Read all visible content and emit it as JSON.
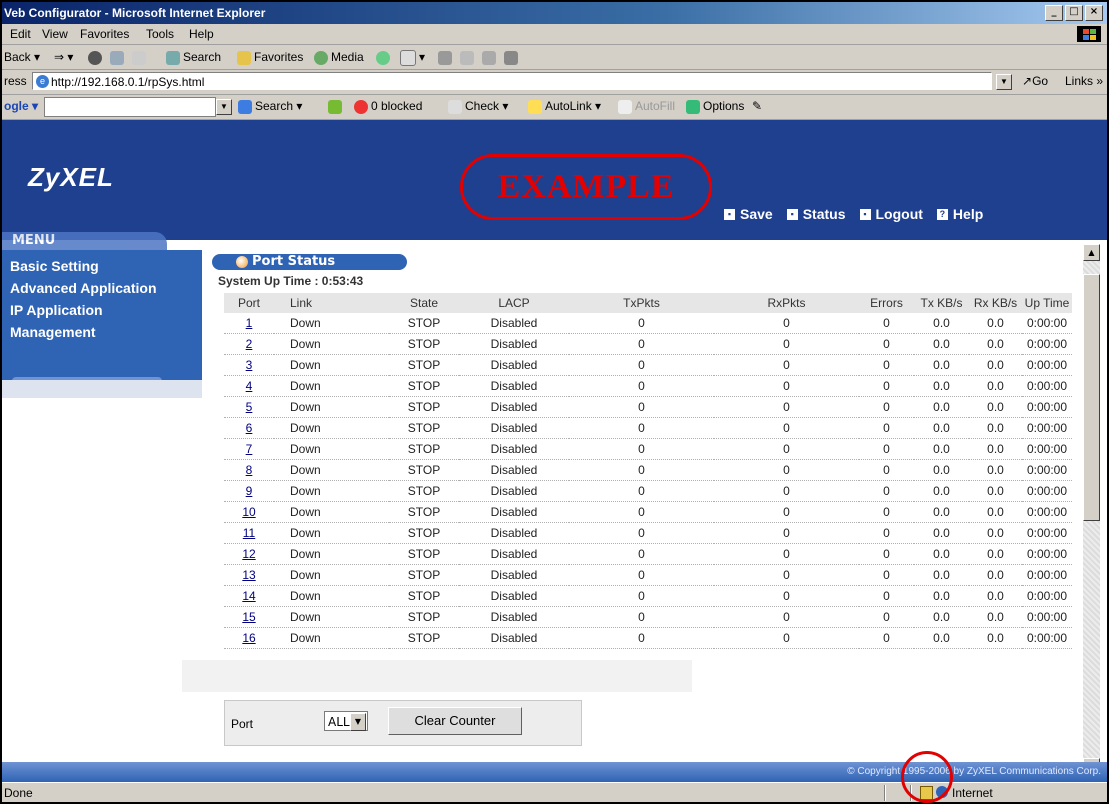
{
  "window": {
    "title": "Veb Configurator - Microsoft Internet Explorer",
    "controls": [
      "_",
      "□",
      "×"
    ]
  },
  "menubar": [
    "Edit",
    "View",
    "Favorites",
    "Tools",
    "Help"
  ],
  "nav_toolbar": {
    "back": "Back",
    "search": "Search",
    "favorites": "Favorites",
    "media": "Media"
  },
  "address_bar": {
    "label": "ress",
    "url": "http://192.168.0.1/rpSys.html",
    "go": "Go",
    "links": "Links »"
  },
  "google_toolbar": {
    "label": "ogle",
    "search": "Search",
    "blocked": "0 blocked",
    "check": "Check",
    "autolink": "AutoLink",
    "autofill": "AutoFill",
    "options": "Options"
  },
  "header": {
    "logo": "ZyXEL",
    "stamp": "EXAMPLE",
    "links": [
      "Save",
      "Status",
      "Logout",
      "Help"
    ]
  },
  "sidebar": {
    "menu_label": "MENU",
    "items": [
      "Basic Setting",
      "Advanced Application",
      "IP Application",
      "Management"
    ]
  },
  "panel": {
    "title": "Port Status",
    "uptime": "System Up Time : 0:53:43"
  },
  "table": {
    "columns": [
      "Port",
      "Link",
      "State",
      "LACP",
      "TxPkts",
      "RxPkts",
      "Errors",
      "Tx KB/s",
      "Rx KB/s",
      "Up Time"
    ],
    "rows": [
      [
        "1",
        "Down",
        "STOP",
        "Disabled",
        "0",
        "0",
        "0",
        "0.0",
        "0.0",
        "0:00:00"
      ],
      [
        "2",
        "Down",
        "STOP",
        "Disabled",
        "0",
        "0",
        "0",
        "0.0",
        "0.0",
        "0:00:00"
      ],
      [
        "3",
        "Down",
        "STOP",
        "Disabled",
        "0",
        "0",
        "0",
        "0.0",
        "0.0",
        "0:00:00"
      ],
      [
        "4",
        "Down",
        "STOP",
        "Disabled",
        "0",
        "0",
        "0",
        "0.0",
        "0.0",
        "0:00:00"
      ],
      [
        "5",
        "Down",
        "STOP",
        "Disabled",
        "0",
        "0",
        "0",
        "0.0",
        "0.0",
        "0:00:00"
      ],
      [
        "6",
        "Down",
        "STOP",
        "Disabled",
        "0",
        "0",
        "0",
        "0.0",
        "0.0",
        "0:00:00"
      ],
      [
        "7",
        "Down",
        "STOP",
        "Disabled",
        "0",
        "0",
        "0",
        "0.0",
        "0.0",
        "0:00:00"
      ],
      [
        "8",
        "Down",
        "STOP",
        "Disabled",
        "0",
        "0",
        "0",
        "0.0",
        "0.0",
        "0:00:00"
      ],
      [
        "9",
        "Down",
        "STOP",
        "Disabled",
        "0",
        "0",
        "0",
        "0.0",
        "0.0",
        "0:00:00"
      ],
      [
        "10",
        "Down",
        "STOP",
        "Disabled",
        "0",
        "0",
        "0",
        "0.0",
        "0.0",
        "0:00:00"
      ],
      [
        "11",
        "Down",
        "STOP",
        "Disabled",
        "0",
        "0",
        "0",
        "0.0",
        "0.0",
        "0:00:00"
      ],
      [
        "12",
        "Down",
        "STOP",
        "Disabled",
        "0",
        "0",
        "0",
        "0.0",
        "0.0",
        "0:00:00"
      ],
      [
        "13",
        "Down",
        "STOP",
        "Disabled",
        "0",
        "0",
        "0",
        "0.0",
        "0.0",
        "0:00:00"
      ],
      [
        "14",
        "Down",
        "STOP",
        "Disabled",
        "0",
        "0",
        "0",
        "0.0",
        "0.0",
        "0:00:00"
      ],
      [
        "15",
        "Down",
        "STOP",
        "Disabled",
        "0",
        "0",
        "0",
        "0.0",
        "0.0",
        "0:00:00"
      ],
      [
        "16",
        "Down",
        "STOP",
        "Disabled",
        "0",
        "0",
        "0",
        "0.0",
        "0.0",
        "0:00:00"
      ]
    ]
  },
  "controls": {
    "port_label": "Port",
    "port_value": "ALL",
    "clear_button": "Clear Counter"
  },
  "footer": {
    "copyright": "© Copyright 1995-2006 by ZyXEL Communications Corp."
  },
  "statusbar": {
    "status": "Done",
    "zone": "Internet"
  },
  "colors": {
    "header_blue": "#1f3f8f",
    "menu_blue": "#2f63b4",
    "stamp_red": "#e30000",
    "link_blue": "#000080"
  }
}
